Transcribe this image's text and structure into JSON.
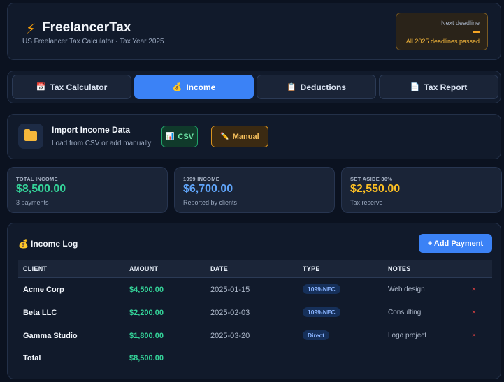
{
  "header": {
    "icon": "lightning-icon",
    "title": "FreelancerTax",
    "subtitle": "US Freelancer Tax Calculator · Tax Year 2025",
    "deadline": {
      "label": "Next deadline",
      "value": "—",
      "status": "All 2025 deadlines passed"
    }
  },
  "tabs": [
    {
      "label": "Tax Calculator",
      "icon": "table-icon"
    },
    {
      "label": "Income",
      "icon": "money-bag-icon"
    },
    {
      "label": "Deductions",
      "icon": "clipboard-icon"
    },
    {
      "label": "Tax Report",
      "icon": "document-icon"
    }
  ],
  "active_tab": "Income",
  "import": {
    "title": "Import Income Data",
    "subtitle": "Load from CSV or add manually",
    "csv_label": "CSV",
    "manual_label": "Manual"
  },
  "stats": {
    "total": {
      "label": "TOTAL INCOME",
      "value": "$8,500.00",
      "sub": "3 payments"
    },
    "form1099": {
      "label": "1099 INCOME",
      "value": "$6,700.00",
      "sub": "Reported by clients"
    },
    "setaside": {
      "label": "SET ASIDE 30%",
      "value": "$2,550.00",
      "sub": "Tax reserve"
    }
  },
  "income_log": {
    "title": "Income Log",
    "add_button": "+ Add Payment",
    "columns": [
      "CLIENT",
      "AMOUNT",
      "DATE",
      "TYPE",
      "NOTES"
    ],
    "rows": [
      {
        "client": "Acme Corp",
        "amount": "$4,500.00",
        "date": "2025-01-15",
        "type": "1099-NEC",
        "notes": "Web design",
        "delete": "×"
      },
      {
        "client": "Beta LLC",
        "amount": "$2,200.00",
        "date": "2025-02-03",
        "type": "1099-NEC",
        "notes": "Consulting",
        "delete": "×"
      },
      {
        "client": "Gamma Studio",
        "amount": "$1,800.00",
        "date": "2025-03-20",
        "type": "Direct",
        "notes": "Logo project",
        "delete": "×"
      }
    ],
    "total_label": "Total",
    "total_amount": "$8,500.00"
  },
  "colors": {
    "background": "#0b1220",
    "accent": "#3b82f6",
    "positive": "#34d399",
    "warning": "#fbbf24",
    "danger": "#ef4444"
  }
}
